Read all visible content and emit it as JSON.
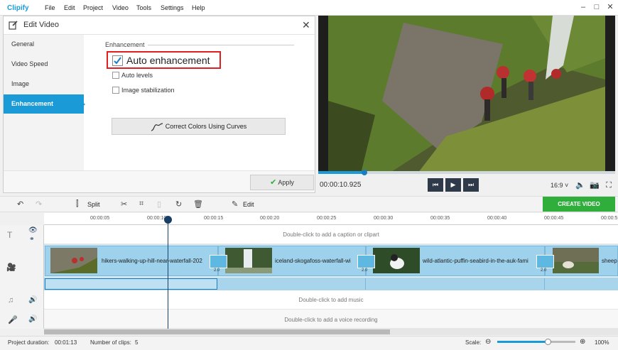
{
  "app": {
    "name": "Clipify"
  },
  "menu": [
    "File",
    "Edit",
    "Project",
    "Video",
    "Tools",
    "Settings",
    "Help"
  ],
  "edit_panel": {
    "title": "Edit Video",
    "sidebar": [
      "General",
      "Video Speed",
      "Image",
      "Enhancement"
    ],
    "active_tab": "Enhancement",
    "section_label": "Enhancement",
    "auto_enhancement": {
      "label": "Auto enhancement",
      "checked": true
    },
    "auto_levels": {
      "label": "Auto levels",
      "checked": false
    },
    "image_stabilization": {
      "label": "Image stabilization",
      "checked": false
    },
    "curves_button": "Correct Colors Using Curves",
    "apply_button": "Apply"
  },
  "player": {
    "timecode": "00:00:10.925",
    "progress": 0.155,
    "aspect_ratio": "16:9 ˅"
  },
  "toolbar": {
    "split_label": "Split",
    "edit_label": "Edit",
    "create_button": "CREATE VIDEO"
  },
  "ruler_ticks": [
    "00:00:05",
    "00:00:10",
    "00:00:15",
    "00:00:20",
    "00:00:25",
    "00:00:30",
    "00:00:35",
    "00:00:40",
    "00:00:45",
    "00:00:5"
  ],
  "timeline": {
    "caption_hint": "Double-click to add a caption or clipart",
    "music_hint": "Double-click to add music",
    "voice_hint": "Double-click to add a voice recording",
    "clips": [
      {
        "name": "hikers-walking-up-hill-near-waterfall-202"
      },
      {
        "name": "iceland-skogafoss-waterfall-wi"
      },
      {
        "name": "wild-atlantic-puffin-seabird-in-the-auk-fami"
      },
      {
        "name": "sheep"
      }
    ],
    "transition_duration": "2.0"
  },
  "status": {
    "duration_label": "Project duration:",
    "duration_value": "00:01:13",
    "clips_label": "Number of clips:",
    "clips_value": "5",
    "scale_label": "Scale:",
    "zoom": "100%",
    "zoom_minus": "⊖",
    "zoom_plus": "⊕"
  },
  "colors": {
    "accent": "#1a9bd7",
    "create": "#2fae3b",
    "highlight": "#e02020"
  }
}
